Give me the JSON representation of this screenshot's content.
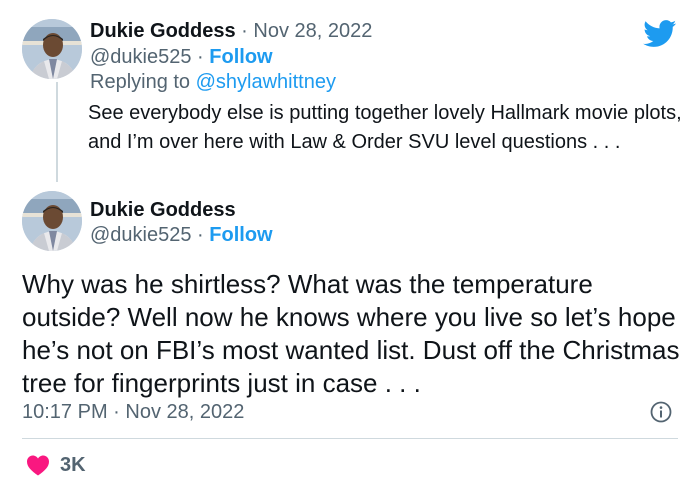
{
  "colors": {
    "accent": "#1d9bf0",
    "like": "#f91880",
    "muted": "#536471",
    "text": "#0f1419"
  },
  "reply_tweet": {
    "display_name": "Dukie Goddess",
    "date_sep": "·",
    "date": "Nov 28, 2022",
    "handle": "@dukie525",
    "handle_sep": "·",
    "follow_label": "Follow",
    "replying_prefix": "Replying to",
    "replying_to": "@shylawhittney",
    "text": "See everybody else is putting together lovely Hallmark movie plots, and I’m over here with Law & Order SVU level questions . . ."
  },
  "main_tweet": {
    "display_name": "Dukie Goddess",
    "handle": "@dukie525",
    "handle_sep": "·",
    "follow_label": "Follow",
    "text": "Why was he shirtless? What was the temperature outside? Well now he knows where you live so let’s hope he’s not on FBI’s most wanted list. Dust off the Christmas tree for fingerprints just in case . . .",
    "time": "10:17 PM",
    "time_sep": "·",
    "date": "Nov 28, 2022",
    "like_count": "3K"
  },
  "icons": {
    "logo": "twitter-bird-icon",
    "info": "info-icon",
    "like": "heart-icon",
    "avatar": "avatar-image"
  }
}
